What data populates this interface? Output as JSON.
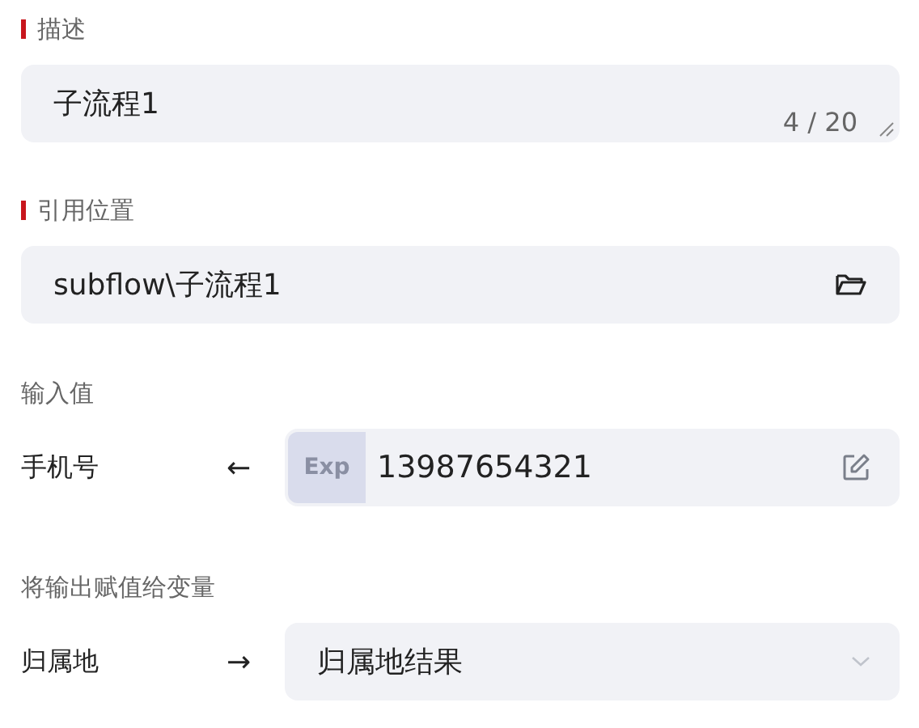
{
  "description": {
    "label": "描述",
    "required": true,
    "value": "子流程1",
    "count": "4 / 20"
  },
  "reference": {
    "label": "引用位置",
    "required": true,
    "value": "subflow\\子流程1"
  },
  "inputs": {
    "label": "输入值",
    "rows": [
      {
        "name": "手机号",
        "arrow": "←",
        "tag": "Exp",
        "value": "13987654321"
      }
    ]
  },
  "outputs": {
    "label": "将输出赋值给变量",
    "rows": [
      {
        "name": "归属地",
        "arrow": "→",
        "value": "归属地结果"
      }
    ]
  }
}
